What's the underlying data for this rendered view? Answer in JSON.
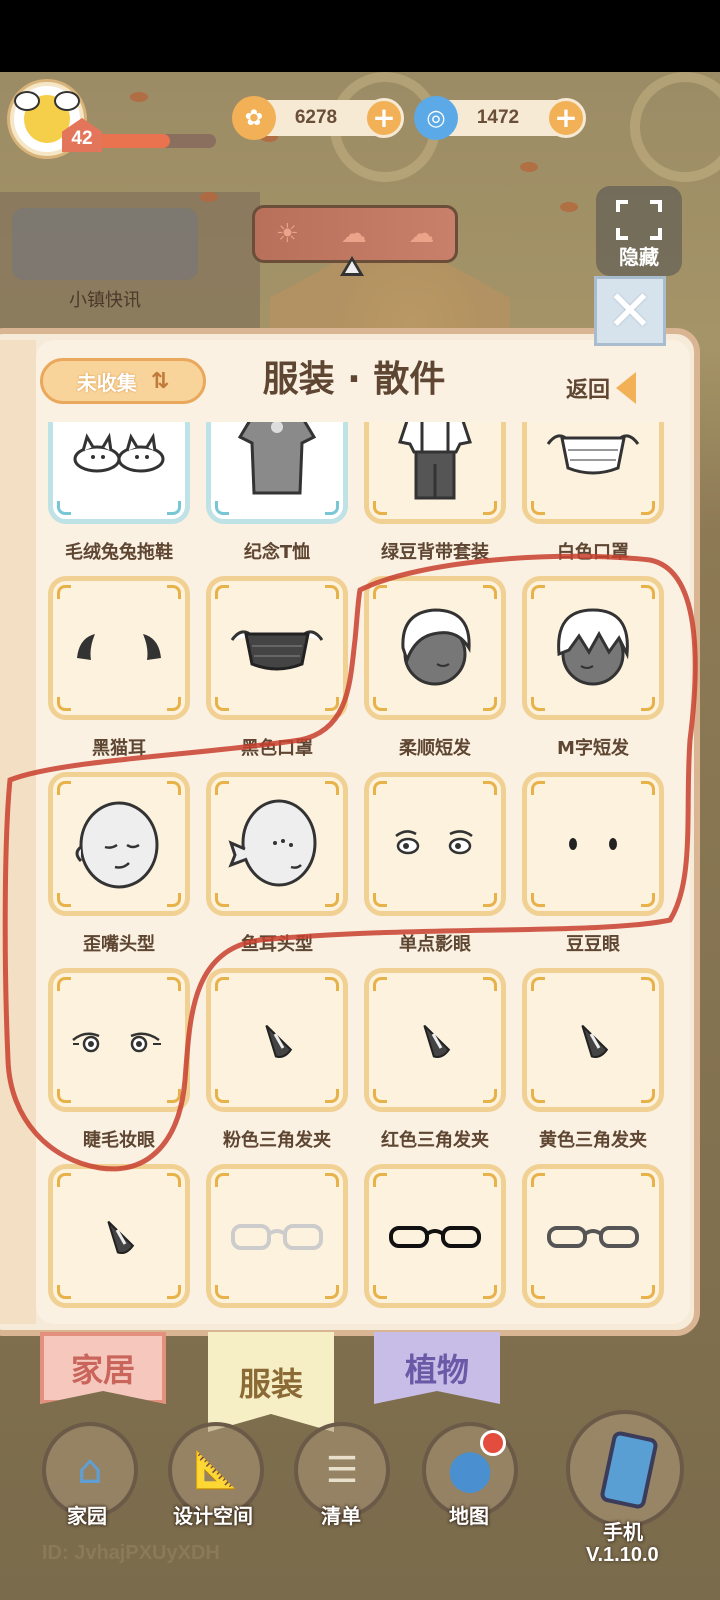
{
  "hud": {
    "level": "42",
    "xp_fraction": 0.62,
    "coins": "6278",
    "gems": "1472",
    "news_label": "小镇快讯",
    "hide_label": "隐藏"
  },
  "panel": {
    "filter_label": "未收集",
    "title": "服装 · 散件",
    "back_label": "返回"
  },
  "items": [
    {
      "label": "毛绒兔兔拖鞋",
      "icon": "bunny-slippers-icon"
    },
    {
      "label": "纪念T恤",
      "icon": "tshirt-icon"
    },
    {
      "label": "绿豆背带套装",
      "icon": "suspender-outfit-icon"
    },
    {
      "label": "白色口罩",
      "icon": "white-mask-icon"
    },
    {
      "label": "黑猫耳",
      "icon": "cat-ears-icon"
    },
    {
      "label": "黑色口罩",
      "icon": "black-mask-icon"
    },
    {
      "label": "柔顺短发",
      "icon": "smooth-short-hair-icon"
    },
    {
      "label": "M字短发",
      "icon": "m-short-hair-icon"
    },
    {
      "label": "歪嘴头型",
      "icon": "crooked-mouth-head-icon"
    },
    {
      "label": "鱼耳头型",
      "icon": "fish-ear-head-icon"
    },
    {
      "label": "单点影眼",
      "icon": "shadow-eyes-icon"
    },
    {
      "label": "豆豆眼",
      "icon": "bean-eyes-icon"
    },
    {
      "label": "睫毛妆眼",
      "icon": "lash-eyes-icon"
    },
    {
      "label": "粉色三角发夹",
      "icon": "hairclip-icon"
    },
    {
      "label": "红色三角发夹",
      "icon": "hairclip-icon"
    },
    {
      "label": "黄色三角发夹",
      "icon": "hairclip-icon"
    },
    {
      "label": "",
      "icon": "hairclip-icon"
    },
    {
      "label": "",
      "icon": "white-glasses-icon"
    },
    {
      "label": "",
      "icon": "black-glasses-icon"
    },
    {
      "label": "",
      "icon": "grey-glasses-icon"
    }
  ],
  "category_tabs": {
    "home": "家居",
    "clothing": "服装",
    "plants": "植物"
  },
  "nav": {
    "homestead": "家园",
    "design": "设计空间",
    "list": "清单",
    "map": "地图",
    "phone": "手机"
  },
  "footer": {
    "player_id": "ID: JvhajPXUyXDH",
    "version": "V.1.10.0"
  },
  "colors": {
    "panel_bg": "#fbf1e2",
    "card_border": "#f1d193",
    "accent": "#f2b157",
    "annotation": "#c8402e"
  }
}
